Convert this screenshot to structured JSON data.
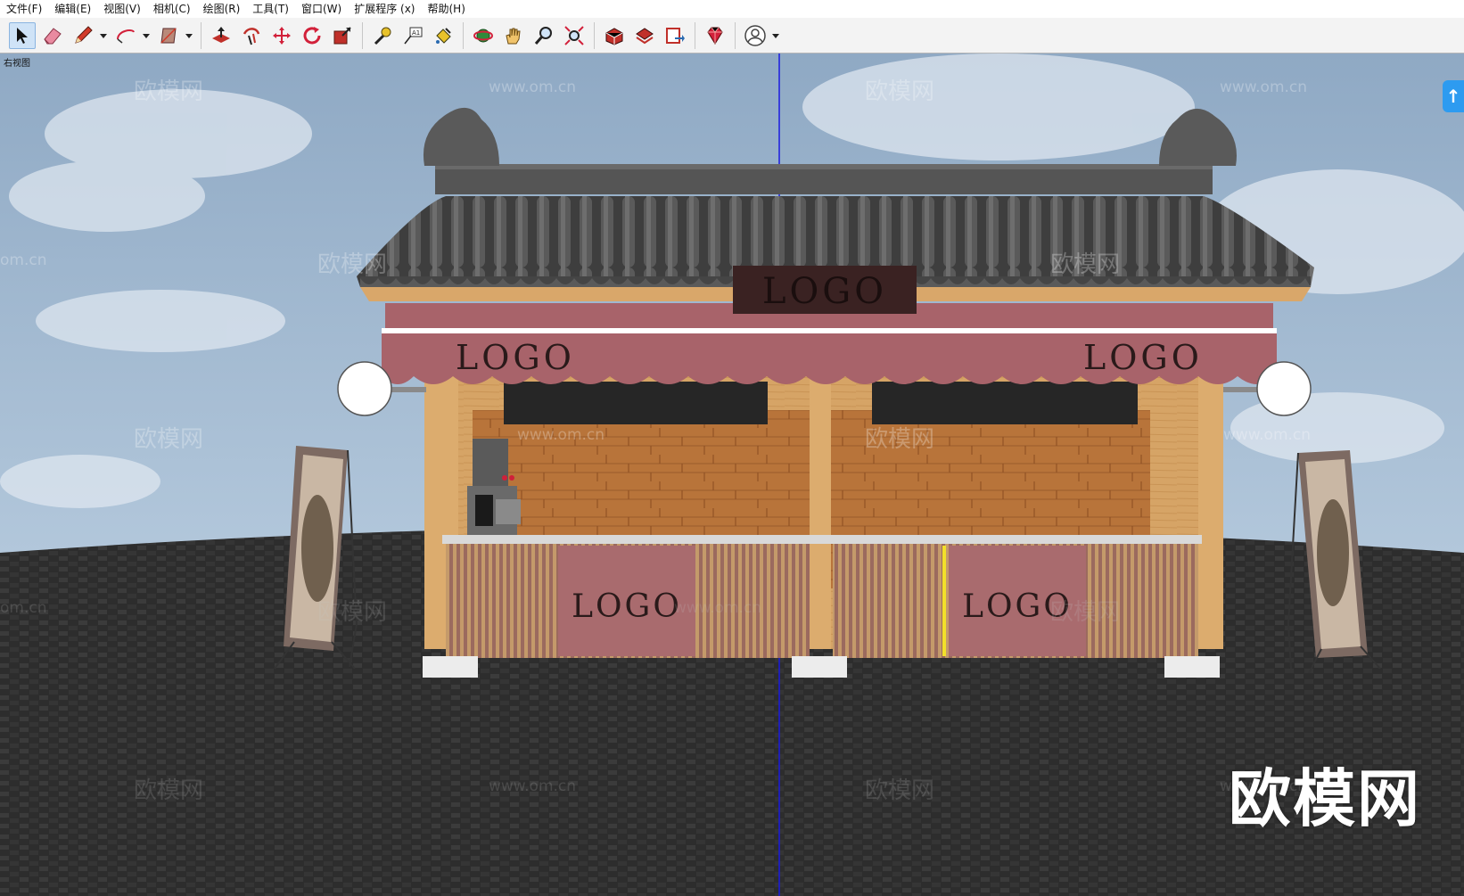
{
  "menubar": {
    "items": [
      "文件(F)",
      "编辑(E)",
      "视图(V)",
      "相机(C)",
      "绘图(R)",
      "工具(T)",
      "窗口(W)",
      "扩展程序 (x)",
      "帮助(H)"
    ]
  },
  "toolbar": {
    "groups": [
      [
        "select-icon",
        "eraser-icon",
        "pencil-icon",
        "arc-icon",
        "rectangle-icon"
      ],
      [
        "push-pull-icon",
        "offset-icon",
        "move-icon",
        "rotate-icon",
        "scale-icon"
      ],
      [
        "tape-measure-icon",
        "text-icon",
        "paint-bucket-icon"
      ],
      [
        "orbit-icon",
        "pan-icon",
        "zoom-icon",
        "zoom-extents-icon"
      ],
      [
        "warehouse-icon",
        "extension-warehouse-icon",
        "send-to-layout-icon"
      ],
      [
        "ruby-icon"
      ],
      [
        "account-icon"
      ]
    ]
  },
  "viewport": {
    "view_label": "右视图",
    "side_button_glyph": "↑",
    "brand_mark": "欧模网",
    "watermark_text": "欧模网",
    "watermark_url": "www.om.cn",
    "watermark_url_partial": "om.cn"
  },
  "kiosk": {
    "roof_sign": "LOGO",
    "awning_left_logo": "LOGO",
    "awning_right_logo": "LOGO",
    "counter_left_logo": "LOGO",
    "counter_right_logo": "LOGO"
  },
  "colors": {
    "sky": "#9fb8d0",
    "ground": "#2d2d2d",
    "roof_tile": "#4a4a4a",
    "wood": "#d9a76a",
    "awning": "#a8636a",
    "counter_panel": "#a96b6e",
    "axis_line": "#1a1ae0"
  }
}
